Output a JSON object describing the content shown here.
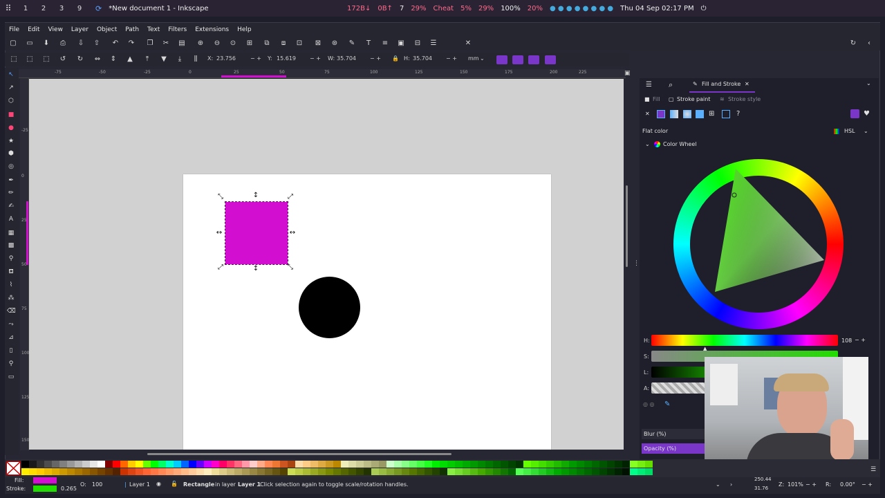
{
  "system_panel": {
    "workspaces": [
      "1",
      "2",
      "3",
      "9"
    ],
    "window_title": "*New document 1 - Inkscape",
    "net": "172B↓",
    "net2": "0B↑",
    "temp": "7",
    "cpu": "29%",
    "cheat": "Cheat",
    "mem": "5%",
    "disk": "29%",
    "battery": "100%",
    "volume": "20%",
    "datetime": "Thu 04 Sep 02:17 PM"
  },
  "menubar": {
    "items": [
      "File",
      "Edit",
      "View",
      "Layer",
      "Object",
      "Path",
      "Text",
      "Filters",
      "Extensions",
      "Help"
    ]
  },
  "controls": {
    "x_label": "X:",
    "x_value": "23.756",
    "y_label": "Y:",
    "y_value": "15.619",
    "w_label": "W:",
    "w_value": "35.704",
    "h_label": "H:",
    "h_value": "35.704",
    "units": "mm"
  },
  "ruler": {
    "h_ticks": [
      "-75",
      "-50",
      "-25",
      "0",
      "25",
      "50",
      "75",
      "100",
      "125",
      "150",
      "175",
      "200",
      "225"
    ],
    "v_ticks": [
      "-25",
      "0",
      "25",
      "50",
      "75",
      "100",
      "125",
      "150"
    ]
  },
  "dock": {
    "tab_title": "Fill and Stroke",
    "fill_tab": "Fill",
    "stroke_paint_tab": "Stroke paint",
    "stroke_style_tab": "Stroke style",
    "flat_color": "Flat color",
    "color_mode": "HSL",
    "color_wheel": "Color Wheel",
    "h_label": "H:",
    "h_value": "108",
    "s_label": "S:",
    "l_label": "L:",
    "a_label": "A:",
    "blur_label": "Blur (%)",
    "opacity_label": "Opacity (%)",
    "unknown_paint": "?"
  },
  "status": {
    "fill_label": "Fill:",
    "stroke_label": "Stroke:",
    "stroke_width": "0.265",
    "opacity_label": "O:",
    "opacity_value": "100",
    "layer": "Layer 1",
    "object_type": "Rectangle",
    "message_mid": "in layer",
    "message_layer": "Layer 1",
    "message_end": ". Click selection again to toggle scale/rotation handles.",
    "cursor_x": "250.44",
    "cursor_y": "31.76",
    "zoom_label": "Z:",
    "zoom": "101%",
    "rotation_label": "R:",
    "rotation": "0.00°"
  },
  "colors": {
    "accent": "#7a36c9",
    "rect_fill": "#d20fd0",
    "circle_fill": "#000000",
    "stroke_color": "#22dd00",
    "page": "#ffffff",
    "canvas_bg": "#d1d1d1"
  },
  "palette": {
    "row1": [
      "#000000",
      "#1a1a1a",
      "#333333",
      "#4d4d4d",
      "#666666",
      "#808080",
      "#999999",
      "#b3b3b3",
      "#cccccc",
      "#e6e6e6",
      "#ffffff",
      "#800000",
      "#ff0000",
      "#ff6600",
      "#ffcc00",
      "#ffff00",
      "#66ff00",
      "#00ff00",
      "#00ff66",
      "#00ffcc",
      "#00ccff",
      "#0066ff",
      "#0000ff",
      "#6600ff",
      "#cc00ff",
      "#ff00cc",
      "#ff0066",
      "#ff3366",
      "#ff6680",
      "#ff99aa",
      "#ffcccc",
      "#ffaa88",
      "#ff8855",
      "#ee7733",
      "#cc5522",
      "#aa4411",
      "#ffddaa",
      "#ffcc88",
      "#eebb66",
      "#ddaa44",
      "#cc9922",
      "#bb8800",
      "#eeeebb",
      "#ddddaa",
      "#cccc99",
      "#bbbb88",
      "#aaaa77",
      "#999966",
      "#ccffcc",
      "#aaffaa",
      "#88ff88",
      "#66ff66",
      "#44ff44",
      "#22ff22",
      "#00ee00",
      "#00dd00",
      "#00cc00",
      "#00bb00",
      "#00aa00",
      "#009900",
      "#008800",
      "#007700",
      "#006600",
      "#005500",
      "#004400",
      "#003300",
      "#66ff00",
      "#55ee00",
      "#44dd00",
      "#33cc00",
      "#22bb00",
      "#11aa00",
      "#009900",
      "#008800",
      "#007700",
      "#006600",
      "#005500",
      "#004400",
      "#003300",
      "#002200",
      "#88ff22",
      "#77ee11",
      "#66dd00"
    ],
    "row2": [
      "#ffee00",
      "#ffdd00",
      "#ffcc00",
      "#eebb00",
      "#ddaa00",
      "#cc9900",
      "#bb8800",
      "#aa7700",
      "#996600",
      "#885500",
      "#774400",
      "#663300",
      "#552200",
      "#cc3300",
      "#dd4411",
      "#ee5522",
      "#ff6633",
      "#ff7744",
      "#ff8855",
      "#ff9966",
      "#ffaa77",
      "#ffbb88",
      "#ffcc99",
      "#ffddaa",
      "#ffeebb",
      "#eedd99",
      "#ddcc88",
      "#ccbb77",
      "#bbaa66",
      "#aa9955",
      "#998844",
      "#887733",
      "#776622",
      "#665511",
      "#554400",
      "#ccdd55",
      "#bbcc44",
      "#aabb33",
      "#99aa22",
      "#889911",
      "#778800",
      "#667700",
      "#556600",
      "#445500",
      "#334400",
      "#223300",
      "#aacc55",
      "#99bb44",
      "#88aa33",
      "#779922",
      "#668811",
      "#557700",
      "#446600",
      "#335500",
      "#224400",
      "#113300",
      "#88ee44",
      "#77dd33",
      "#66cc22",
      "#55bb11",
      "#44aa00",
      "#339900",
      "#228800",
      "#117700",
      "#006600",
      "#55ff55",
      "#44ee44",
      "#33dd33",
      "#22cc22",
      "#11bb11",
      "#00aa00",
      "#009900",
      "#008800",
      "#007700",
      "#006600",
      "#005500",
      "#004400",
      "#003300",
      "#002200",
      "#001100",
      "#00ff88",
      "#00ee77",
      "#00dd66"
    ]
  }
}
